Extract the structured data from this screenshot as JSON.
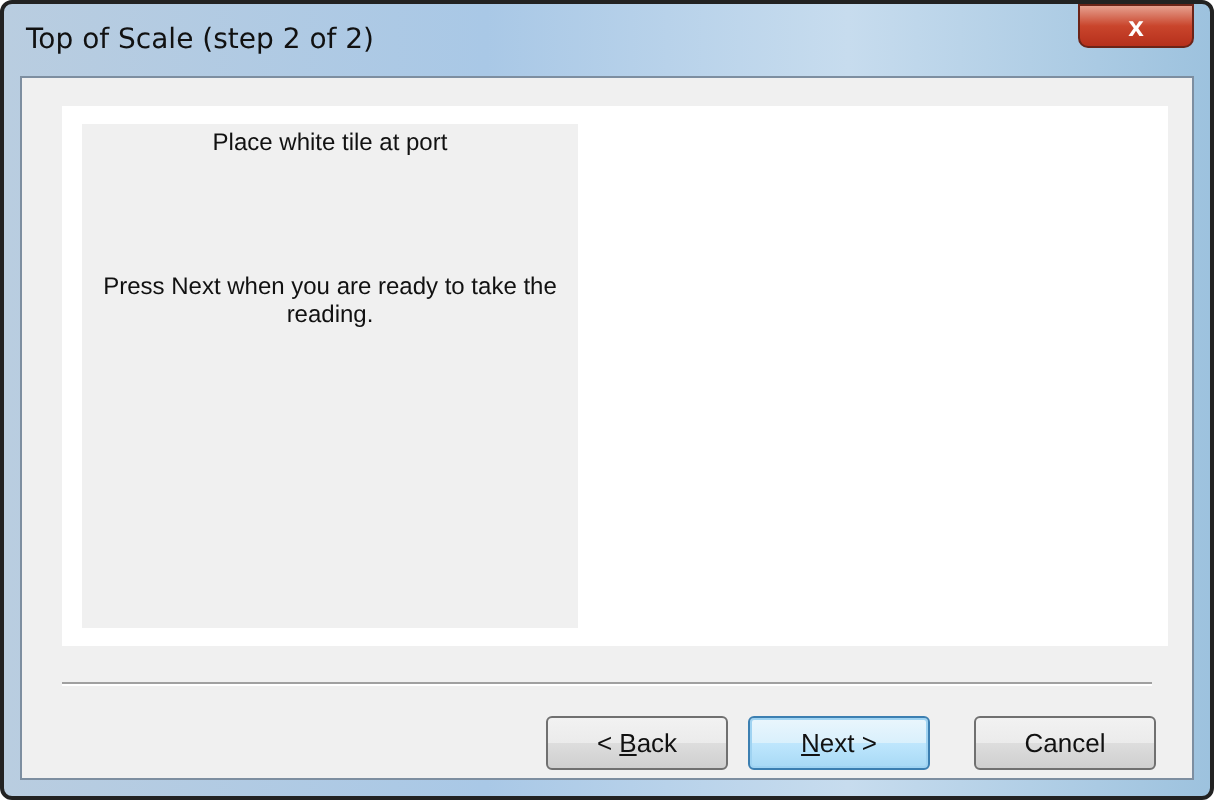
{
  "window": {
    "title": "Top of Scale (step 2 of 2)",
    "close": "x"
  },
  "instruction_panel": {
    "heading": "Place white tile at port",
    "message": "Press Next when you are ready to take the reading."
  },
  "buttons": [
    {
      "before": "< ",
      "access_key": "B",
      "after": "ack",
      "default": false
    },
    {
      "access_key": "N",
      "after": "ext >",
      "default": true
    },
    {
      "before": "Cancel",
      "default": false
    }
  ]
}
